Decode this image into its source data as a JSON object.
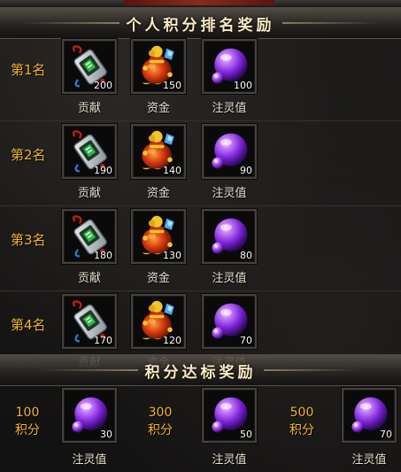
{
  "personal_section": {
    "title": "个人积分排名奖励",
    "ranks": [
      {
        "rank_label": "第1名",
        "rewards": [
          {
            "icon": "contribution-token-icon",
            "quantity": "200",
            "label": "贡献"
          },
          {
            "icon": "gold-bag-icon",
            "quantity": "150",
            "label": "资金"
          },
          {
            "icon": "spirit-orb-icon",
            "quantity": "100",
            "label": "注灵值"
          }
        ]
      },
      {
        "rank_label": "第2名",
        "rewards": [
          {
            "icon": "contribution-token-icon",
            "quantity": "190",
            "label": "贡献"
          },
          {
            "icon": "gold-bag-icon",
            "quantity": "140",
            "label": "资金"
          },
          {
            "icon": "spirit-orb-icon",
            "quantity": "90",
            "label": "注灵值"
          }
        ]
      },
      {
        "rank_label": "第3名",
        "rewards": [
          {
            "icon": "contribution-token-icon",
            "quantity": "180",
            "label": "贡献"
          },
          {
            "icon": "gold-bag-icon",
            "quantity": "130",
            "label": "资金"
          },
          {
            "icon": "spirit-orb-icon",
            "quantity": "80",
            "label": "注灵值"
          }
        ]
      },
      {
        "rank_label": "第4名",
        "rewards": [
          {
            "icon": "contribution-token-icon",
            "quantity": "170",
            "label": "贡献"
          },
          {
            "icon": "gold-bag-icon",
            "quantity": "120",
            "label": "资金"
          },
          {
            "icon": "spirit-orb-icon",
            "quantity": "70",
            "label": "注灵值"
          }
        ]
      }
    ]
  },
  "milestone_section": {
    "title": "积分达标奖励",
    "milestones": [
      {
        "points": "100",
        "unit": "积分",
        "icon": "spirit-orb-icon",
        "quantity": "30",
        "label": "注灵值"
      },
      {
        "points": "300",
        "unit": "积分",
        "icon": "spirit-orb-icon",
        "quantity": "50",
        "label": "注灵值"
      },
      {
        "points": "500",
        "unit": "积分",
        "icon": "spirit-orb-icon",
        "quantity": "70",
        "label": "注灵值"
      }
    ]
  },
  "colors": {
    "rank_gold": "#f2b52a",
    "title_cream": "#f6ecc8",
    "label_text": "#e6e0d0",
    "slot_border": "#45403a",
    "orb_purple": "#a24cf0"
  }
}
